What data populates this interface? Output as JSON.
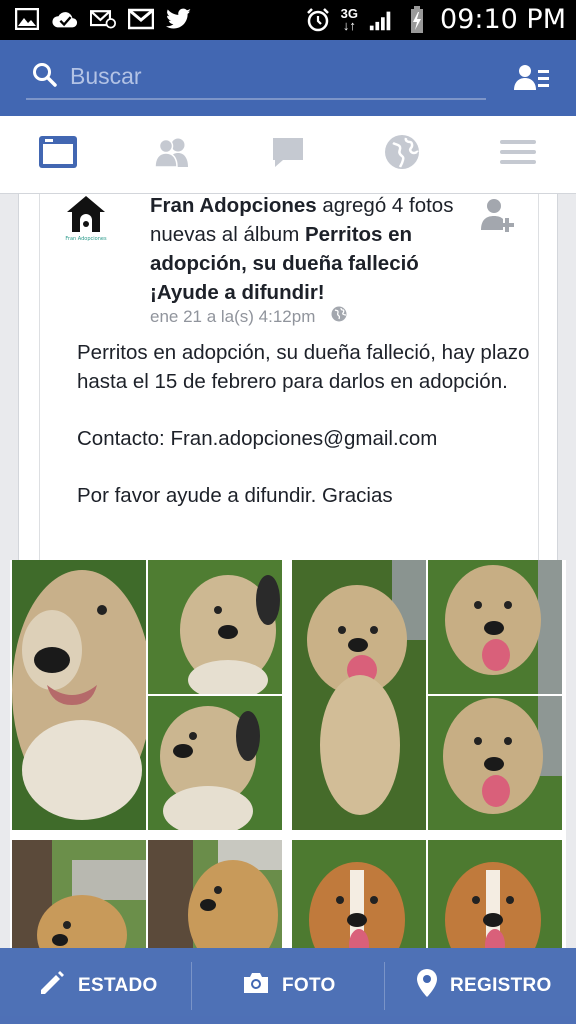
{
  "status_bar": {
    "time": "09:10 PM",
    "network": "3G",
    "left_icons": [
      "gallery-icon",
      "check-cloud-icon",
      "mail-at-icon",
      "gmail-icon",
      "twitter-icon"
    ],
    "right_icons": [
      "alarm-icon",
      "3g-icon",
      "signal-icon",
      "battery-charging-icon"
    ]
  },
  "search": {
    "placeholder": "Buscar"
  },
  "tabs": [
    "news-feed-tab",
    "friend-requests-tab",
    "messages-tab",
    "notifications-tab",
    "menu-tab"
  ],
  "post": {
    "author": "Fran Adopciones",
    "action_1": " agregó 4 fotos nuevas al álbum ",
    "album": "Perritos en adopción, su dueña falleció ¡Ayude a difundir!",
    "timestamp": "ene 21 a la(s) 4:12pm",
    "body": "Perritos en adopción, su dueña falleció, hay plazo hasta el 15 de febrero para darlos en adopción.\n\nContacto: Fran.adopciones@gmail.com\n\nPor favor ayude a difundir. Gracias"
  },
  "bottom_bar": {
    "status_label": "ESTADO",
    "photo_label": "FOTO",
    "checkin_label": "REGISTRO"
  },
  "colors": {
    "brand_blue": "#4267b2",
    "text": "#1d2129",
    "meta": "#90949c"
  }
}
